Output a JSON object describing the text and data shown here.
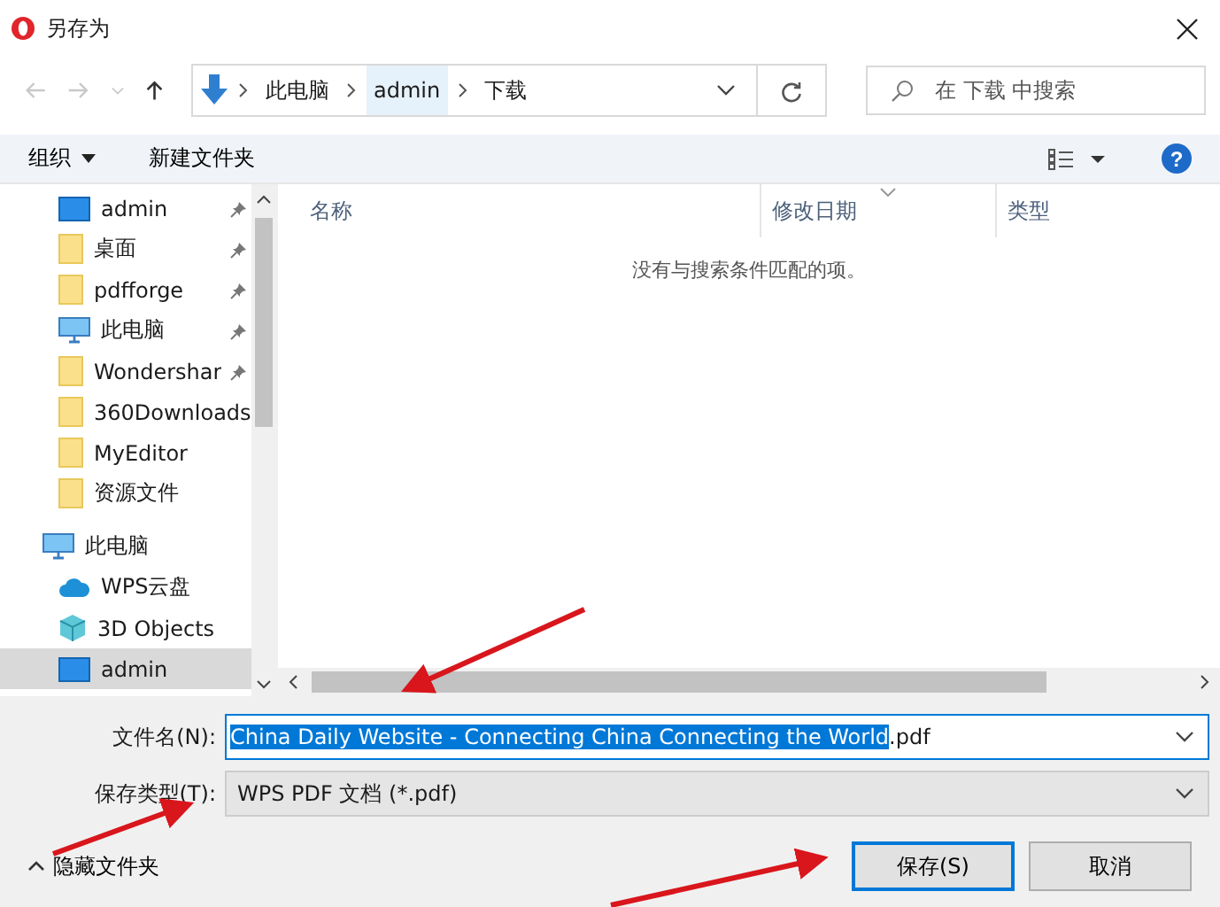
{
  "window": {
    "title": "另存为"
  },
  "nav": {
    "back": {
      "disabled": true
    },
    "forward": {
      "disabled": true
    },
    "up": {
      "disabled": false
    },
    "breadcrumb": [
      "此电脑",
      "admin",
      "下载"
    ],
    "search": {
      "placeholder": "在 下载 中搜索"
    }
  },
  "toolbar": {
    "organize": "组织",
    "new_folder": "新建文件夹",
    "help": "?"
  },
  "sidebar": {
    "items": [
      {
        "label": "admin",
        "kind": "desktop",
        "pinned": true,
        "selected": false
      },
      {
        "label": "桌面",
        "kind": "folder",
        "pinned": true,
        "selected": false
      },
      {
        "label": "pdfforge",
        "kind": "folder",
        "pinned": true,
        "selected": false
      },
      {
        "label": "此电脑",
        "kind": "pc",
        "pinned": true,
        "selected": false
      },
      {
        "label": "Wondershar",
        "kind": "folder",
        "pinned": true,
        "selected": false
      },
      {
        "label": "360Downloads",
        "kind": "folder",
        "pinned": false,
        "selected": false
      },
      {
        "label": "MyEditor",
        "kind": "folder",
        "pinned": false,
        "selected": false
      },
      {
        "label": "资源文件",
        "kind": "folder",
        "pinned": false,
        "selected": false
      },
      {
        "label": "此电脑",
        "kind": "pc",
        "pinned": false,
        "selected": false,
        "children": [
          {
            "label": "WPS云盘",
            "kind": "cloud",
            "pinned": false,
            "selected": false
          },
          {
            "label": "3D Objects",
            "kind": "cube",
            "pinned": false,
            "selected": false
          },
          {
            "label": "admin",
            "kind": "desktop",
            "pinned": false,
            "selected": true
          }
        ]
      }
    ]
  },
  "table": {
    "columns": [
      "名称",
      "修改日期",
      "类型"
    ],
    "empty_message": "没有与搜索条件匹配的项。"
  },
  "form": {
    "filename_label": "文件名(N):",
    "filename_selected": "China Daily Website - Connecting China Connecting the World",
    "filename_rest": ".pdf",
    "type_label": "保存类型(T):",
    "type_value": "WPS PDF 文档 (*.pdf)"
  },
  "footer": {
    "hide_folders": "隐藏文件夹",
    "buttons": [
      {
        "label": "保存(S)",
        "kind": "primary"
      },
      {
        "label": "取消",
        "kind": "normal"
      }
    ]
  }
}
